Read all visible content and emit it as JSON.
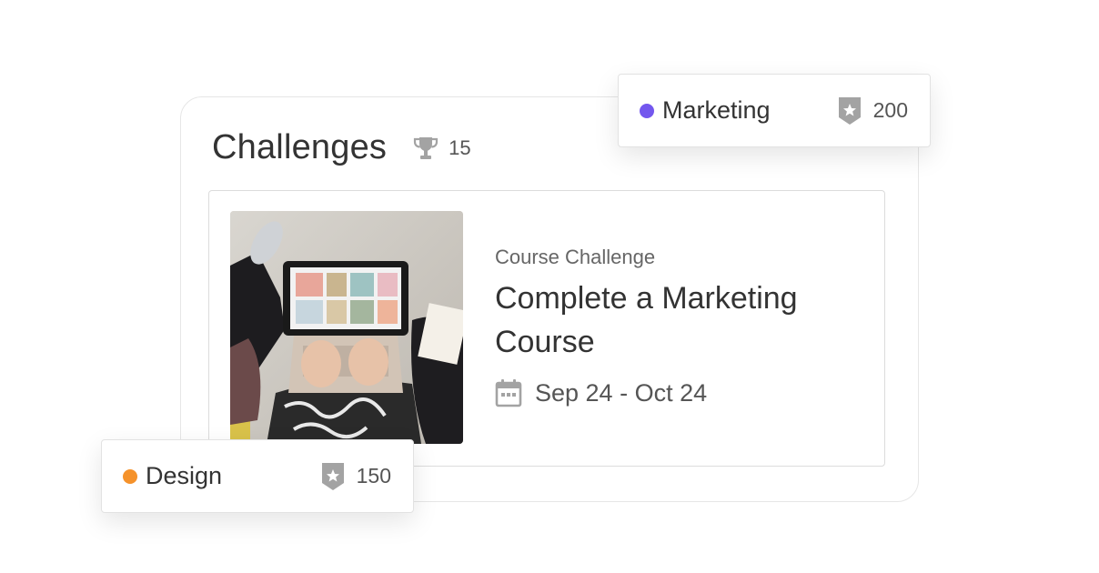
{
  "header": {
    "title": "Challenges",
    "trophy_icon": "trophy-icon",
    "trophy_count": "15"
  },
  "challenge": {
    "image_description": "laptop-photo",
    "type": "Course Challenge",
    "title": "Complete a Marketing Course",
    "dates": "Sep 24 - Oct 24",
    "date_icon": "calendar-icon"
  },
  "tags": [
    {
      "label": "Marketing",
      "dot_color": "#7357ee",
      "badge_icon": "star-badge-icon",
      "points": "200"
    },
    {
      "label": "Design",
      "dot_color": "#f5922b",
      "badge_icon": "star-badge-icon",
      "points": "150"
    }
  ],
  "colors": {
    "text": "#333333",
    "muted": "#666666",
    "icon": "#a3a3a3",
    "border": "#e2e2e2"
  }
}
